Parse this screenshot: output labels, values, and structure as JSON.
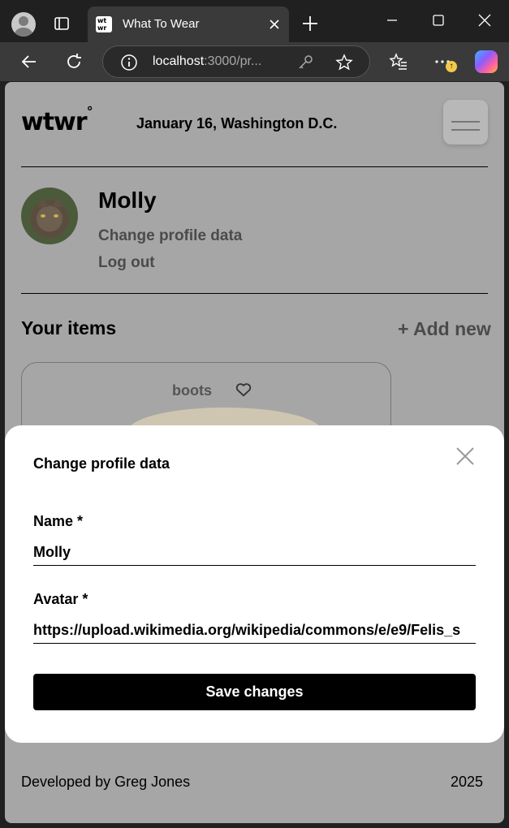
{
  "browser": {
    "tab_title": "What To Wear",
    "favicon_text": "wt wr",
    "url_host": "localhost",
    "url_rest": ":3000/pr...",
    "notification_badge": "↑"
  },
  "header": {
    "logo": "wtwr",
    "logo_mark": "°",
    "date_location": "January 16, Washington D.C."
  },
  "profile": {
    "name": "Molly",
    "change_profile_link": "Change profile data",
    "logout_link": "Log out"
  },
  "items_section": {
    "title": "Your items",
    "add_new": "+ Add new",
    "cards": [
      {
        "name": "boots"
      }
    ]
  },
  "footer": {
    "credit": "Developed by Greg Jones",
    "year": "2025"
  },
  "modal": {
    "title": "Change profile data",
    "name_label": "Name *",
    "name_value": "Molly",
    "avatar_label": "Avatar *",
    "avatar_value": "https://upload.wikimedia.org/wikipedia/commons/e/e9/Felis_s",
    "save_label": "Save changes"
  },
  "colors": {
    "overlay_bg": "#a6a6a6",
    "modal_bg": "#ffffff",
    "button_bg": "#000000",
    "browser_chrome": "#202020"
  }
}
